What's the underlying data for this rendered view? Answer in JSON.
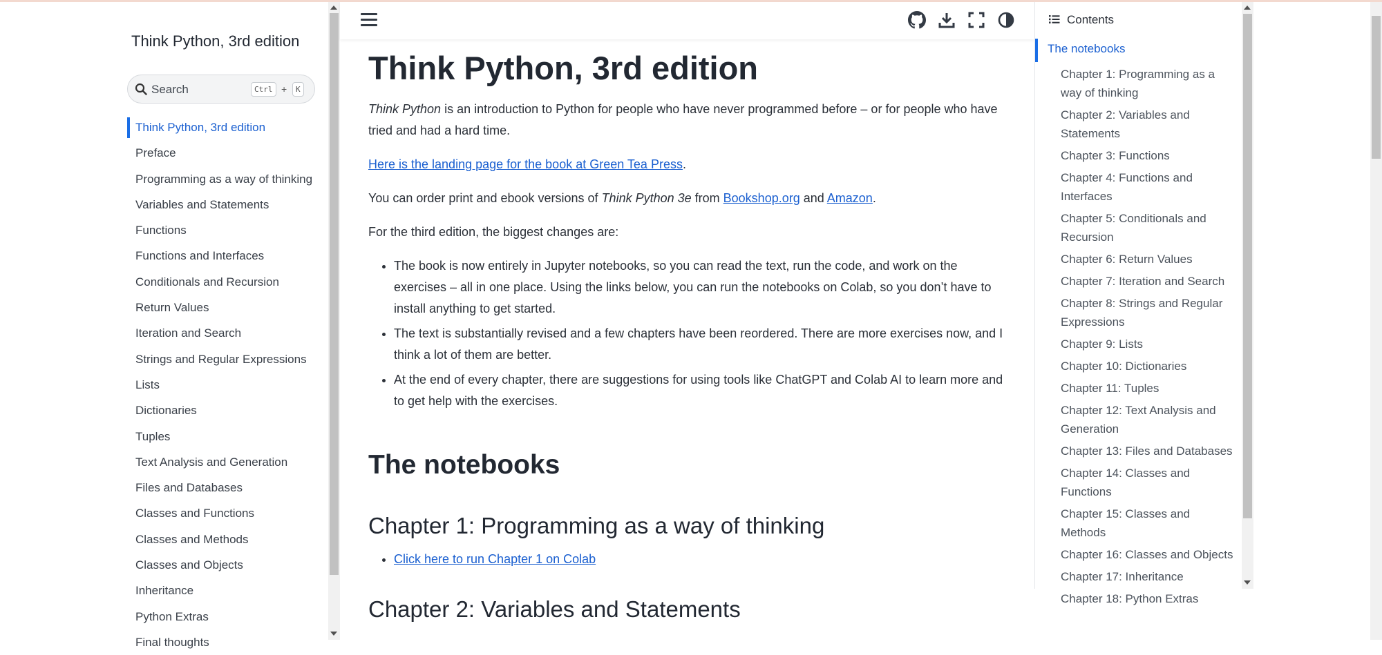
{
  "site_title": "Think Python, 3rd edition",
  "search": {
    "placeholder": "Search",
    "shortcut_ctrl": "Ctrl",
    "shortcut_plus": "+",
    "shortcut_key": "K"
  },
  "left_nav": [
    "Think Python, 3rd edition",
    "Preface",
    "Programming as a way of thinking",
    "Variables and Statements",
    "Functions",
    "Functions and Interfaces",
    "Conditionals and Recursion",
    "Return Values",
    "Iteration and Search",
    "Strings and Regular Expressions",
    "Lists",
    "Dictionaries",
    "Tuples",
    "Text Analysis and Generation",
    "Files and Databases",
    "Classes and Functions",
    "Classes and Methods",
    "Classes and Objects",
    "Inheritance",
    "Python Extras",
    "Final thoughts"
  ],
  "header_icons": [
    "menu-icon",
    "github-icon",
    "download-icon",
    "fullscreen-icon",
    "theme-toggle-icon"
  ],
  "main": {
    "title": "Think Python, 3rd edition",
    "intro_italic": "Think Python",
    "intro_rest": " is an introduction to Python for people who have never programmed before – or for people who have tried and had a hard time.",
    "landing_link": "Here is the landing page for the book at Green Tea Press",
    "landing_period": ".",
    "order_pre": "You can order print and ebook versions of ",
    "order_italic": "Think Python 3e",
    "order_from": " from ",
    "bookshop_link": "Bookshop.org",
    "order_and": " and ",
    "amazon_link": "Amazon",
    "order_end": ".",
    "changes_intro": "For the third edition, the biggest changes are:",
    "changes": [
      "The book is now entirely in Jupyter notebooks, so you can read the text, run the code, and work on the exercises – all in one place. Using the links below, you can run the notebooks on Colab, so you don’t have to install anything to get started.",
      "The text is substantially revised and a few chapters have been reordered. There are more exercises now, and I think a lot of them are better.",
      "At the end of every chapter, there are suggestions for using tools like ChatGPT and Colab AI to learn more and to get help with the exercises."
    ],
    "notebooks_heading": "The notebooks",
    "ch1_heading": "Chapter 1: Programming as a way of thinking",
    "ch1_link": "Click here to run Chapter 1 on Colab",
    "ch2_heading": "Chapter 2: Variables and Statements"
  },
  "toc": {
    "title": "Contents",
    "active": "The notebooks",
    "items": [
      "Chapter 1: Programming as a way of thinking",
      "Chapter 2: Variables and Statements",
      "Chapter 3: Functions",
      "Chapter 4: Functions and Interfaces",
      "Chapter 5: Conditionals and Recursion",
      "Chapter 6: Return Values",
      "Chapter 7: Iteration and Search",
      "Chapter 8: Strings and Regular Expressions",
      "Chapter 9: Lists",
      "Chapter 10: Dictionaries",
      "Chapter 11: Tuples",
      "Chapter 12: Text Analysis and Generation",
      "Chapter 13: Files and Databases",
      "Chapter 14: Classes and Functions",
      "Chapter 15: Classes and Methods",
      "Chapter 16: Classes and Objects",
      "Chapter 17: Inheritance",
      "Chapter 18: Python Extras"
    ]
  },
  "colors": {
    "accent": "#1a5fd0",
    "text": "#222832"
  }
}
